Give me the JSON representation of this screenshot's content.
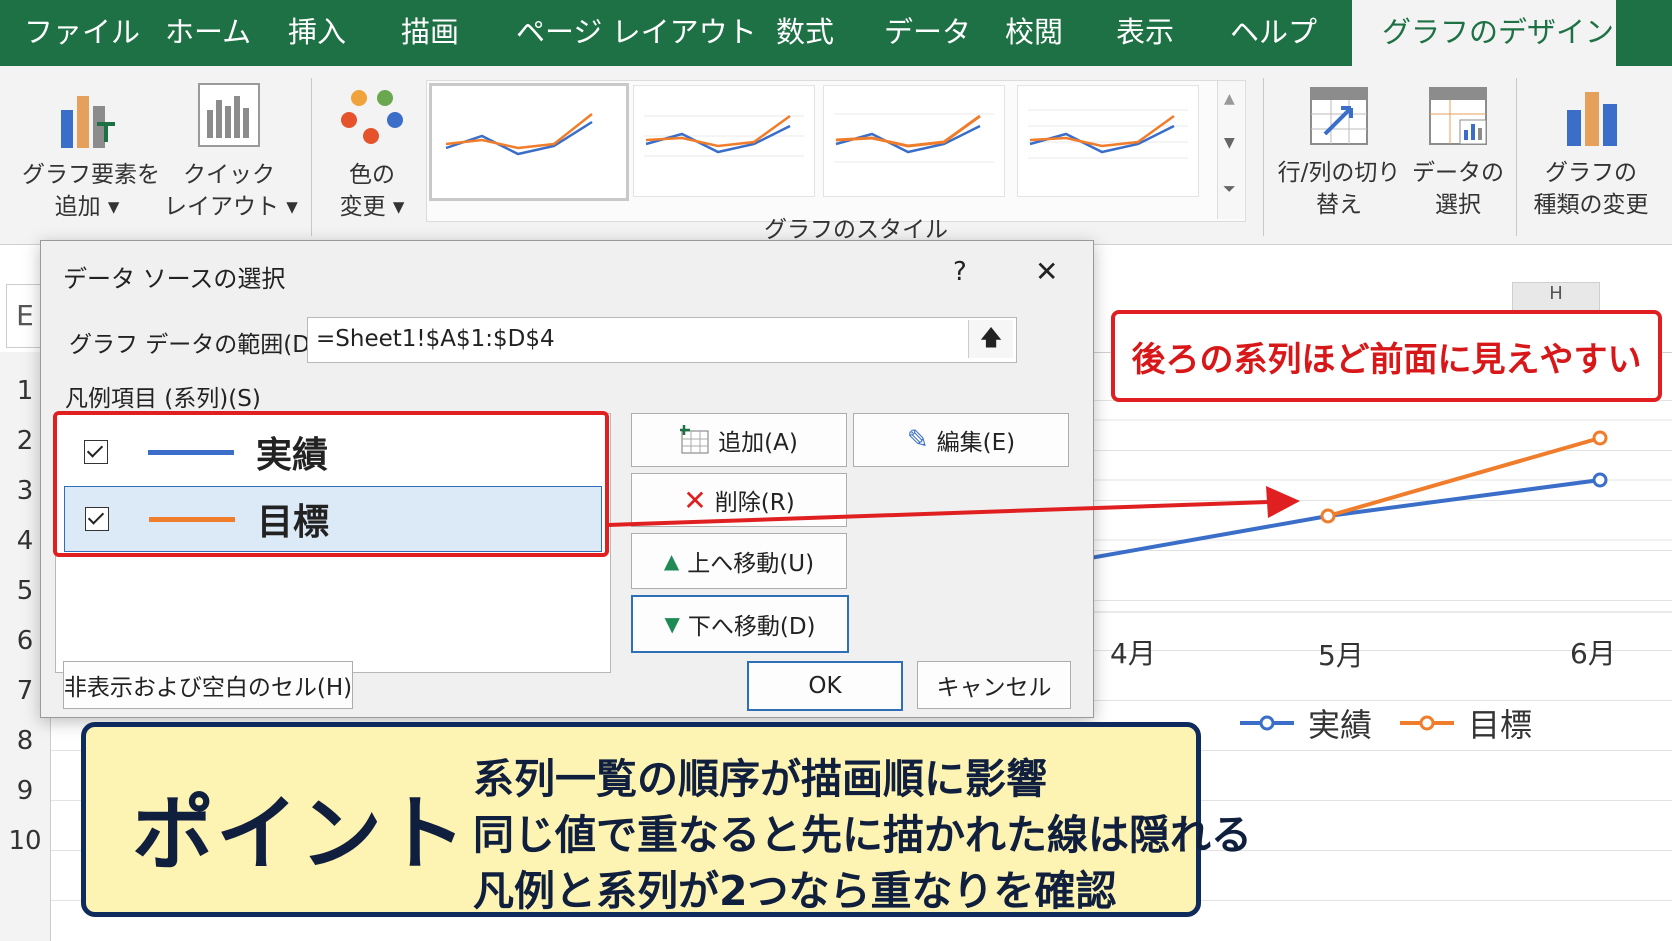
{
  "ribbon": {
    "tabs": [
      "ファイル",
      "ホーム",
      "挿入",
      "描画",
      "ページ レイアウト",
      "数式",
      "データ",
      "校閲",
      "表示",
      "ヘルプ",
      "グラフのデザイン"
    ],
    "active_tab": "グラフのデザイン",
    "groups": {
      "add_element": [
        "グラフ要素を",
        "追加 ▾"
      ],
      "quick_layout": [
        "クイック",
        "レイアウト ▾"
      ],
      "change_colors": [
        "色の",
        "変更 ▾"
      ],
      "switch_row_col": [
        "行/列の切り",
        "替え"
      ],
      "select_data": [
        "データの",
        "選択"
      ],
      "change_type": [
        "グラフの",
        "種類の変更"
      ]
    },
    "styles_label": "グラフのスタイル"
  },
  "sheet": {
    "rows": [
      "1",
      "2",
      "3",
      "4",
      "5",
      "6",
      "7",
      "8",
      "9",
      "10"
    ],
    "name_box_fragment": "E",
    "column_fragment": "H"
  },
  "chart": {
    "x_labels": [
      "4月",
      "5月",
      "6月"
    ],
    "legend": [
      "実績",
      "目標"
    ],
    "colors": {
      "actual": "#3a6ec8",
      "target": "#f07d2b"
    }
  },
  "dialog": {
    "title": "データ ソースの選択",
    "help": "?",
    "close": "✕",
    "range_label": "グラフ データの範囲(D):",
    "range_value": "=Sheet1!$A$1:$D$4",
    "legend_label": "凡例項目 (系列)(S)",
    "series": [
      {
        "name": "実績",
        "color": "#3a6ec8",
        "checked": true
      },
      {
        "name": "目標",
        "color": "#f07d2b",
        "checked": true
      }
    ],
    "buttons": {
      "add": "追加(A)",
      "edit": "編集(E)",
      "delete": "削除(R)",
      "move_up": "上へ移動(U)",
      "move_down": "下へ移動(D)",
      "hidden_cells": "非表示および空白のセル(H)",
      "ok": "OK",
      "cancel": "キャンセル"
    }
  },
  "callout": "後ろの系列ほど前面に見えやすい",
  "point": {
    "title": "ポイント",
    "lines": [
      "系列一覧の順序が描画順に影響",
      "同じ値で重なると先に描かれた線は隠れる",
      "凡例と系列が2つなら重なりを確認"
    ]
  }
}
